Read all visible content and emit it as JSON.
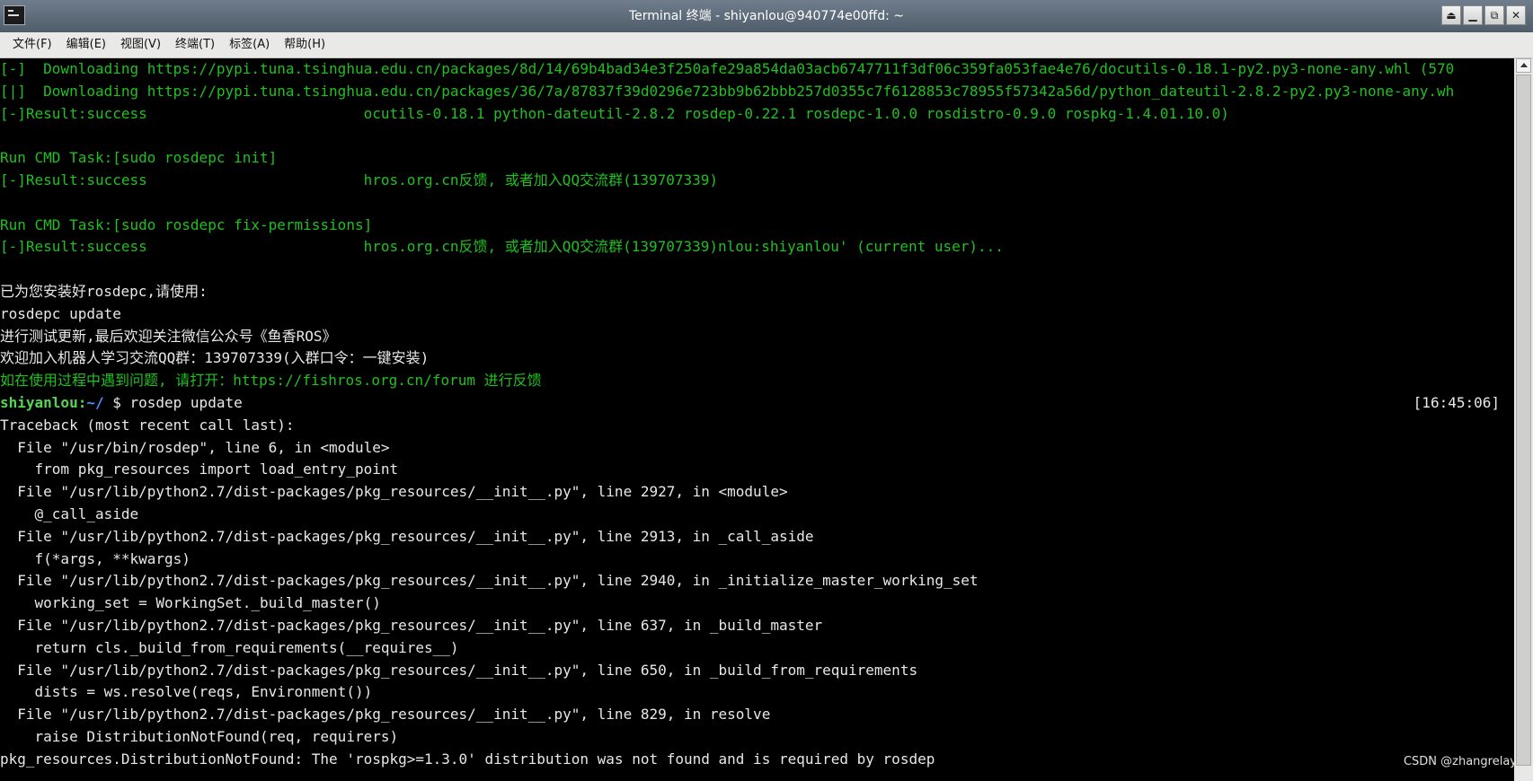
{
  "window": {
    "title": "Terminal 终端 - shiyanlou@940774e00ffd: ~",
    "controls": [
      "⏏",
      "▁",
      "⧉",
      "✕"
    ]
  },
  "menu": [
    "文件(F)",
    "编辑(E)",
    "视图(V)",
    "终端(T)",
    "标签(A)",
    "帮助(H)"
  ],
  "terminal": {
    "lines": [
      {
        "segments": [
          {
            "text": "[-]  Downloading https://pypi.tuna.tsinghua.edu.cn/packages/8d/14/69b4bad34e3f250afe29a854da03acb6747711f3df06c359fa053fae4e76/docutils-0.18.1-py2.py3-none-any.whl (570",
            "cls": "g"
          }
        ]
      },
      {
        "segments": [
          {
            "text": "[|]  Downloading https://pypi.tuna.tsinghua.edu.cn/packages/36/7a/87837f39d0296e723bb9b62bbb257d0355c7f6128853c78955f57342a56d/python_dateutil-2.8.2-py2.py3-none-any.wh",
            "cls": "g"
          }
        ]
      },
      {
        "segments": [
          {
            "text": "[-]Result:success                         ocutils-0.18.1 python-dateutil-2.8.2 rosdep-0.22.1 rosdepc-1.0.0 rosdistro-0.9.0 rospkg-1.4.01.10.0)",
            "cls": "g"
          }
        ]
      },
      {
        "segments": []
      },
      {
        "segments": [
          {
            "text": "Run CMD Task:[sudo rosdepc init]",
            "cls": "g"
          }
        ]
      },
      {
        "segments": [
          {
            "text": "[-]Result:success                         hros.org.cn反馈, 或者加入QQ交流群(139707339)",
            "cls": "g"
          }
        ]
      },
      {
        "segments": []
      },
      {
        "segments": [
          {
            "text": "Run CMD Task:[sudo rosdepc fix-permissions]",
            "cls": "g"
          }
        ]
      },
      {
        "segments": [
          {
            "text": "[-]Result:success                         hros.org.cn反馈, 或者加入QQ交流群(139707339)nlou:shiyanlou' (current user)...",
            "cls": "g"
          }
        ]
      },
      {
        "segments": []
      },
      {
        "segments": [
          {
            "text": "已为您安装好rosdepc,请使用:",
            "cls": "w"
          }
        ]
      },
      {
        "segments": [
          {
            "text": "rosdepc update",
            "cls": "w"
          }
        ]
      },
      {
        "segments": [
          {
            "text": "进行测试更新,最后欢迎关注微信公众号《鱼香ROS》",
            "cls": "w"
          }
        ]
      },
      {
        "segments": [
          {
            "text": "欢迎加入机器人学习交流QQ群：139707339(入群口令：一键安装)",
            "cls": "w"
          }
        ]
      },
      {
        "segments": [
          {
            "text": "如在使用过程中遇到问题, 请打开：https://fishros.org.cn/forum 进行反馈",
            "cls": "g"
          }
        ]
      },
      {
        "segments": [
          {
            "text": "shiyanlou:",
            "cls": "prompt-user"
          },
          {
            "text": "~/",
            "cls": "prompt-path"
          },
          {
            "text": " $ rosdep update",
            "cls": "w"
          }
        ],
        "timestamp": "[16:45:06]"
      },
      {
        "segments": [
          {
            "text": "Traceback (most recent call last):",
            "cls": "w"
          }
        ]
      },
      {
        "segments": [
          {
            "text": "  File \"/usr/bin/rosdep\", line 6, in <module>",
            "cls": "w"
          }
        ]
      },
      {
        "segments": [
          {
            "text": "    from pkg_resources import load_entry_point",
            "cls": "w"
          }
        ]
      },
      {
        "segments": [
          {
            "text": "  File \"/usr/lib/python2.7/dist-packages/pkg_resources/__init__.py\", line 2927, in <module>",
            "cls": "w"
          }
        ]
      },
      {
        "segments": [
          {
            "text": "    @_call_aside",
            "cls": "w"
          }
        ]
      },
      {
        "segments": [
          {
            "text": "  File \"/usr/lib/python2.7/dist-packages/pkg_resources/__init__.py\", line 2913, in _call_aside",
            "cls": "w"
          }
        ]
      },
      {
        "segments": [
          {
            "text": "    f(*args, **kwargs)",
            "cls": "w"
          }
        ]
      },
      {
        "segments": [
          {
            "text": "  File \"/usr/lib/python2.7/dist-packages/pkg_resources/__init__.py\", line 2940, in _initialize_master_working_set",
            "cls": "w"
          }
        ]
      },
      {
        "segments": [
          {
            "text": "    working_set = WorkingSet._build_master()",
            "cls": "w"
          }
        ]
      },
      {
        "segments": [
          {
            "text": "  File \"/usr/lib/python2.7/dist-packages/pkg_resources/__init__.py\", line 637, in _build_master",
            "cls": "w"
          }
        ]
      },
      {
        "segments": [
          {
            "text": "    return cls._build_from_requirements(__requires__)",
            "cls": "w"
          }
        ]
      },
      {
        "segments": [
          {
            "text": "  File \"/usr/lib/python2.7/dist-packages/pkg_resources/__init__.py\", line 650, in _build_from_requirements",
            "cls": "w"
          }
        ]
      },
      {
        "segments": [
          {
            "text": "    dists = ws.resolve(reqs, Environment())",
            "cls": "w"
          }
        ]
      },
      {
        "segments": [
          {
            "text": "  File \"/usr/lib/python2.7/dist-packages/pkg_resources/__init__.py\", line 829, in resolve",
            "cls": "w"
          }
        ]
      },
      {
        "segments": [
          {
            "text": "    raise DistributionNotFound(req, requirers)",
            "cls": "w"
          }
        ]
      },
      {
        "segments": [
          {
            "text": "pkg_resources.DistributionNotFound: The 'rospkg>=1.3.0' distribution was not found and is required by rosdep",
            "cls": "w"
          }
        ]
      }
    ]
  },
  "watermark": "CSDN @zhangrelay"
}
